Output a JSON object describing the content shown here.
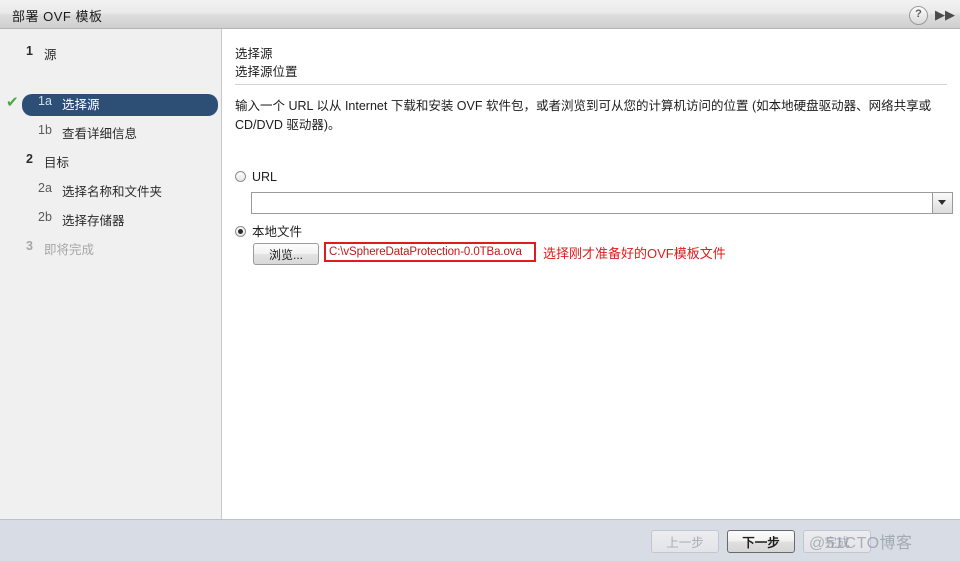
{
  "window": {
    "title": "部署 OVF 模板",
    "help_icon": "help-circle-icon",
    "expand_icon": "double-chevron-right-icon"
  },
  "sidebar": {
    "items": [
      {
        "num": "1",
        "label": "源",
        "level": "major",
        "state": "normal",
        "check": false
      },
      {
        "num": "1a",
        "label": "选择源",
        "level": "sub",
        "state": "selected",
        "check": true
      },
      {
        "num": "1b",
        "label": "查看详细信息",
        "level": "sub",
        "state": "normal",
        "check": false
      },
      {
        "num": "2",
        "label": "目标",
        "level": "major",
        "state": "normal",
        "check": false
      },
      {
        "num": "2a",
        "label": "选择名称和文件夹",
        "level": "sub",
        "state": "normal",
        "check": false
      },
      {
        "num": "2b",
        "label": "选择存储器",
        "level": "sub",
        "state": "normal",
        "check": false
      },
      {
        "num": "3",
        "label": "即将完成",
        "level": "major",
        "state": "disabled",
        "check": false
      }
    ],
    "check_glyph": "✔"
  },
  "content": {
    "heading": "选择源",
    "subheading": "选择源位置",
    "description": "输入一个 URL 以从 Internet 下载和安装 OVF 软件包，或者浏览到可从您的计算机访问的位置 (如本地硬盘驱动器、网络共享或 CD/DVD 驱动器)。",
    "url_option": {
      "label": "URL",
      "selected": false,
      "value": "",
      "placeholder": ""
    },
    "local_option": {
      "label": "本地文件",
      "selected": true,
      "browse_label": "浏览...",
      "file_path": "C:\\vSphereDataProtection-0.0TBa.ova"
    },
    "annotation": "选择刚才准备好的OVF模板文件",
    "annotation_color": "#e01b1b"
  },
  "footer": {
    "back_label": "上一步",
    "back_enabled": false,
    "next_label": "下一步",
    "next_enabled": true,
    "finish_label": "完成",
    "finish_enabled": false,
    "watermark": "@51CTO博客"
  }
}
